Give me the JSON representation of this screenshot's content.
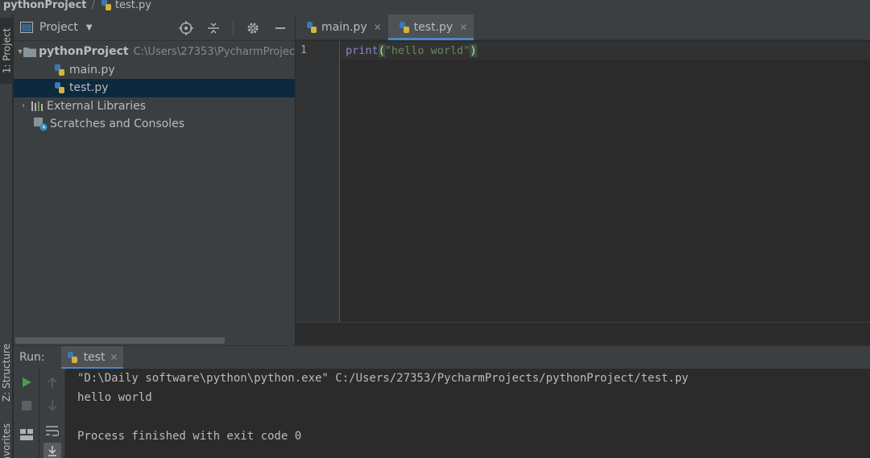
{
  "breadcrumb": {
    "project": "pythonProject",
    "separator": "/",
    "file": "test.py"
  },
  "left_stripe": {
    "project_tab": "1: Project",
    "structure_tab": "Z: Structure",
    "favorites_tab": "Favorites"
  },
  "project_panel": {
    "title": "Project",
    "tree": [
      {
        "name": "pythonProject",
        "path": "C:\\Users\\27353\\PycharmProjec",
        "expanded": true
      },
      {
        "name": "main.py"
      },
      {
        "name": "test.py",
        "selected": true
      },
      {
        "name": "External Libraries"
      },
      {
        "name": "Scratches and Consoles"
      }
    ]
  },
  "editor": {
    "tabs": [
      {
        "label": "main.py",
        "active": false
      },
      {
        "label": "test.py",
        "active": true
      }
    ],
    "line_number": "1",
    "code": {
      "fn": "print",
      "open": "(",
      "str": "\"hello world\"",
      "close": ")"
    }
  },
  "run_panel": {
    "label": "Run:",
    "tab": "test",
    "console": [
      "\"D:\\Daily software\\python\\python.exe\" C:/Users/27353/PycharmProjects/pythonProject/test.py",
      "hello world",
      "",
      "Process finished with exit code 0"
    ]
  },
  "colors": {
    "accent": "#4a88c7",
    "selection": "#0d293e",
    "run_green": "#499c54"
  }
}
